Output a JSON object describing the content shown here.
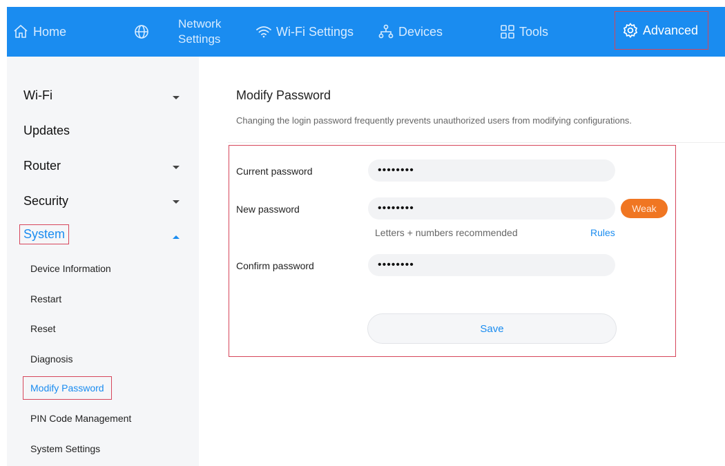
{
  "topnav": {
    "home": "Home",
    "network_line1": "Network",
    "network_line2": "Settings",
    "wifi": "Wi-Fi Settings",
    "devices": "Devices",
    "tools": "Tools",
    "advanced": "Advanced"
  },
  "sidebar": {
    "wifi": "Wi-Fi",
    "updates": "Updates",
    "router": "Router",
    "security": "Security",
    "system": "System",
    "sub": {
      "device_information": "Device Information",
      "restart": "Restart",
      "reset": "Reset",
      "diagnosis": "Diagnosis",
      "modify_password": "Modify Password",
      "pin_code": "PIN Code Management",
      "system_settings": "System Settings"
    }
  },
  "main": {
    "title": "Modify Password",
    "description": "Changing the login password frequently prevents unauthorized users from modifying configurations.",
    "current_label": "Current password",
    "current_value": "••••••••",
    "new_label": "New password",
    "new_value": "••••••••",
    "strength": "Weak",
    "hint": "Letters + numbers recommended",
    "rules": "Rules",
    "confirm_label": "Confirm password",
    "confirm_value": "••••••••",
    "save": "Save"
  },
  "colors": {
    "accent": "#1a8cf0",
    "highlight_border": "#d6455a",
    "weak": "#f07622"
  }
}
